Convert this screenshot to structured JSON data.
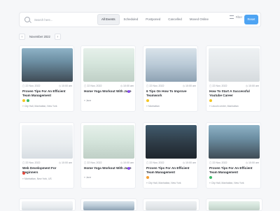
{
  "search": {
    "placeholder": "Search here..."
  },
  "tabs": [
    {
      "label": "All Events",
      "active": true
    },
    {
      "label": "Scheduled"
    },
    {
      "label": "Postponed"
    },
    {
      "label": "Cancelled"
    },
    {
      "label": "Moved Online"
    }
  ],
  "toolbar": {
    "filter_label": "Filter",
    "reset_label": "Reset"
  },
  "date_nav": {
    "prev": "‹",
    "current": "November 2022",
    "next": "›"
  },
  "cards": [
    {
      "date": "22 Nov, 2022",
      "time": "10:00 am",
      "title": "Proven Tips For An Efficient Team Management",
      "location": "City Hall, Manhattan, New York"
    },
    {
      "date": "22 Nov, 2022",
      "time": "10:00 am",
      "title": "Home Yoga Workout With Jane",
      "location": "Jane"
    },
    {
      "date": "22 Nov, 2022",
      "time": "10:00 am",
      "title": "6 Tips On How To Improve Teamwork",
      "location": "Manhattan"
    },
    {
      "date": "22 Nov, 2022",
      "time": "10:00 am",
      "title": "How To Start A Successful Youtube Career",
      "location": "Lincoln center, Manhattan"
    },
    {
      "date": "22 Nov, 2022",
      "time": "10:00 am",
      "title": "Web Development For Beginners",
      "location": "Manhattan, New York, US"
    },
    {
      "date": "22 Nov, 2022",
      "time": "10:00 am",
      "title": "Home Yoga Workout With Jane",
      "location": "Jane"
    },
    {
      "date": "22 Nov, 2022",
      "time": "10:00 am",
      "title": "Proven Tips For An Efficient Team Management",
      "location": "City Hall, Manhattan, New York"
    },
    {
      "date": "22 Nov, 2022",
      "time": "10:00 am",
      "title": "Proven Tips For An Efficient Team Management",
      "location": "City Hall, Manhattan, New York"
    }
  ],
  "colors": {
    "accent": "#4ea4f3",
    "yellow": "#f3c623",
    "green": "#3dbb6a",
    "purple": "#8a4df0",
    "red": "#e6483d",
    "orange": "#f59e2f"
  }
}
